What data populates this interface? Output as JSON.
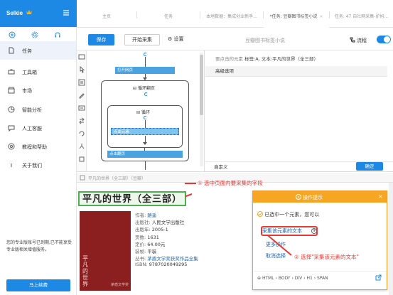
{
  "sidebar": {
    "brand": "Selkie",
    "items": [
      {
        "label": "任务",
        "active": true
      },
      {
        "label": "工具箱"
      },
      {
        "label": "市场"
      },
      {
        "label": "智能分析"
      },
      {
        "label": "人工客服"
      },
      {
        "label": "教程和帮助"
      },
      {
        "label": "关于我们"
      }
    ],
    "notice": "您的专业版账号已到期,已不能享受专业版相关增值服务。",
    "renew_label": "马上续费"
  },
  "tabs": [
    {
      "label": "主页"
    },
    {
      "label": "任务"
    },
    {
      "label": "本地数据：集成创业新手..."
    },
    {
      "label": "*任务: 豆瓣图书标签小说",
      "active": true
    },
    {
      "label": "任务: 47 自社网采集-驴妈..."
    }
  ],
  "toolbar": {
    "save": "保存",
    "start": "开始采集",
    "settings": "设置",
    "task_name": "豆瓣图书标签小说",
    "flow": "流程"
  },
  "workflow": {
    "open_page": "打开网页",
    "loop_page": "循环翻页",
    "loop": "循环",
    "click_element": "点击元素",
    "click_next": "点击翻页"
  },
  "right_panel": {
    "hint_prefix": "要点击的元素",
    "hint_value": "标签:A, 文本:平凡的世界（全三部）",
    "advanced": "高级选项",
    "custom": "自定义",
    "ok": "确定"
  },
  "browser": {
    "url": "平凡的世界（全三部）（豆瓣）",
    "book_title": "平凡的世界（全三部）",
    "cover_title": "平凡的世界",
    "cover_sub": "茅盾文学奖",
    "rows": [
      {
        "k": "作者:",
        "v": "路遥",
        "link": true
      },
      {
        "k": "出版社:",
        "v": "人民文学出版社"
      },
      {
        "k": "出版年:",
        "v": "2005-1"
      },
      {
        "k": "页数:",
        "v": "1631"
      },
      {
        "k": "定价:",
        "v": "64.00元"
      },
      {
        "k": "装帧:",
        "v": "平装"
      },
      {
        "k": "丛书:",
        "v": "茅盾文学奖获奖作品全集",
        "link": true
      },
      {
        "k": "ISBN:",
        "v": "9787020049295"
      }
    ]
  },
  "annotations": {
    "a1": "① 选中页面内要采集的字段",
    "a2": "② 选择\"采集该元素的文本\""
  },
  "tip": {
    "title": "操作提示",
    "message": "已选中一个元素，您可以",
    "collect": "采集该元素的文本",
    "more": "更多操作",
    "cancel": "取消选择",
    "crumbs": "HTML › BODY › DIV › H1 › SPAN"
  },
  "colors": {
    "accent": "#1e88e5",
    "warn": "#f6a623",
    "annotation": "#e53935"
  }
}
